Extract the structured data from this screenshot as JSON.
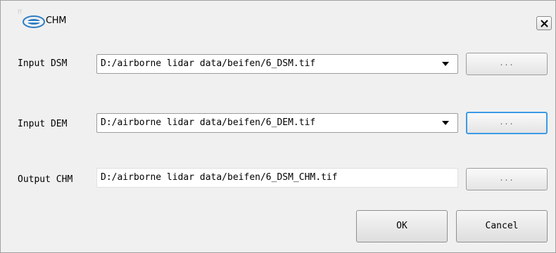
{
  "window": {
    "title": "CHM",
    "faint_mark": "ff",
    "logo_icon": "lidar-logo-icon",
    "close_icon": "close-icon"
  },
  "rows": {
    "dsm": {
      "label": "Input DSM",
      "value": "D:/airborne lidar data/beifen/6_DSM.tif",
      "browse_label": "..."
    },
    "dem": {
      "label": "Input DEM",
      "value": "D:/airborne lidar data/beifen/6_DEM.tif",
      "browse_label": "..."
    },
    "chm": {
      "label": "Output CHM",
      "value": "D:/airborne lidar data/beifen/6_DSM_CHM.tif",
      "browse_label": "..."
    }
  },
  "buttons": {
    "ok": "OK",
    "cancel": "Cancel"
  },
  "colors": {
    "dialog_bg": "#f0f0f0",
    "focus_ring": "#3c9be6",
    "logo_blue": "#2e7dc4"
  }
}
